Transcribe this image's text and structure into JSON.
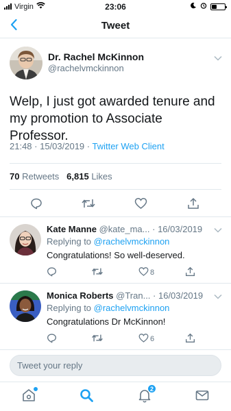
{
  "status_bar": {
    "carrier": "Virgin",
    "time": "23:06",
    "battery_level": 0.35
  },
  "header": {
    "title": "Tweet",
    "back_icon": "chevron-left-icon"
  },
  "tweet": {
    "author_name": "Dr. Rachel McKinnon",
    "author_handle": "@rachelvmckinnon",
    "text": "Welp, I just got awarded tenure and my promotion to Associate Professor.",
    "timestamp": "21:48 · 15/03/2019 · ",
    "client": "Twitter Web Client",
    "retweets_count": "70",
    "retweets_label": "Retweets",
    "likes_count": "6,815",
    "likes_label": "Likes"
  },
  "replies": [
    {
      "name": "Kate Manne",
      "handle": "@kate_ma...",
      "date": "· 16/03/2019",
      "replying_prefix": "Replying to ",
      "replying_to": "@rachelvmckinnon",
      "text": "Congratulations! So well-deserved.",
      "likes": "8"
    },
    {
      "name": "Monica Roberts",
      "handle": "@Tran...",
      "date": "· 16/03/2019",
      "replying_prefix": "Replying to ",
      "replying_to": "@rachelvmckinnon",
      "text": "Congratulations Dr McKinnon!",
      "likes": "6"
    }
  ],
  "compose": {
    "placeholder": "Tweet your reply"
  },
  "tabbar": {
    "notifications_badge": "2",
    "items": [
      "home-icon",
      "search-icon",
      "notifications-icon",
      "messages-icon"
    ]
  },
  "colors": {
    "accent": "#1da1f2",
    "text": "#14171a",
    "muted": "#657786",
    "divider": "#e1e8ed"
  }
}
